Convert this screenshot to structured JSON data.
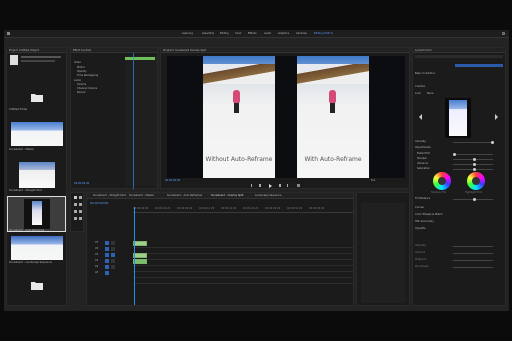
{
  "app": {
    "workspaces": [
      "Learning",
      "Assembly",
      "Editing",
      "Color",
      "Effects",
      "Audio",
      "Graphics",
      "Libraries",
      "Editing (CS5.5)"
    ]
  },
  "project_panel": {
    "title": "Project: Untitled_Project",
    "items": [
      {
        "name": "Untitled Folder"
      },
      {
        "name": "Snowboard - Master"
      },
      {
        "name": "Snowboard - Straight Shot"
      },
      {
        "name": "Snowboard - Auto Reframed"
      },
      {
        "name": "Snowboard - Landscape Sequence"
      }
    ]
  },
  "effect_controls": {
    "title": "Effect Controls",
    "rows": [
      "Video",
      "Motion",
      "Opacity",
      "Time Remapping",
      "Audio",
      "Volume",
      "Channel Volume",
      "Panner"
    ],
    "timecode": "00:00:00:00"
  },
  "program_monitor": {
    "title": "Program: Snowboard Overlay Split",
    "left_caption": "Without Auto-Reframe",
    "right_caption": "With Auto-Reframe",
    "timecode": "00:00:00:00",
    "fit": "Full"
  },
  "timeline": {
    "tabs": [
      "Snowboard - Straight Shot",
      "Snowboard - Master",
      "Snowboard - Auto Reframed",
      "Snowboard - Overlay Split",
      "Landscape Sequence"
    ],
    "timecode": "00:00:00:00",
    "ruler": [
      "00:00:00:00",
      "00:00:04:29",
      "00:00:09:29",
      "00:00:14:29",
      "00:00:19:29",
      "00:00:24:29",
      "00:00:29:29",
      "00:00:34:29",
      "00:00:39:29"
    ],
    "tracks": [
      "V3",
      "V2",
      "V1",
      "A1",
      "A2",
      "A3"
    ]
  },
  "lumetri": {
    "title": "Lumetri Color",
    "section_basic": "Basic Correction",
    "section_creative": "Creative",
    "section_curves": "Curves",
    "look_label": "Look",
    "look_value": "None",
    "intensity_label": "Intensity",
    "adjustments": [
      "Adjustments",
      "Faded Film",
      "Sharpen",
      "Vibrance",
      "Saturation"
    ],
    "wheel_shadow": "Shadow Tint",
    "wheel_highlight": "Highlight Tint",
    "tint_balance": "Tint Balance",
    "more_sections": [
      "Curves",
      "Color Wheels & Match",
      "HSL Secondary",
      "Vignette"
    ],
    "lower_labels": [
      "Intensity",
      "Amount",
      "Midpoint",
      "Roundness"
    ]
  },
  "colors": {
    "accent_blue": "#2d8ceb",
    "panel": "#1b1b1b",
    "clip_green": "#9ed08a"
  }
}
